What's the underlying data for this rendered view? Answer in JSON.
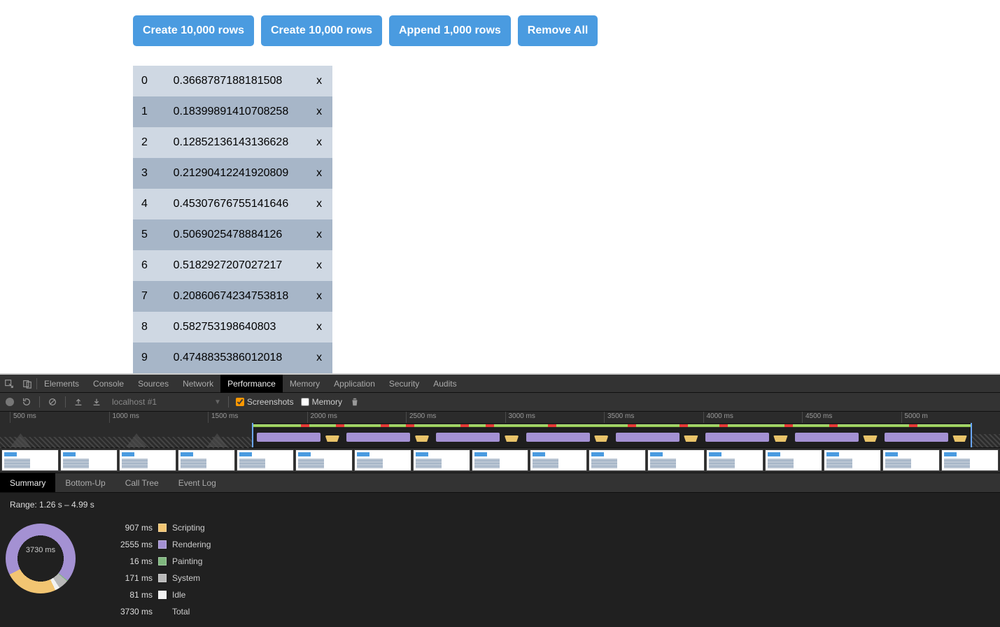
{
  "buttons": {
    "create10k_a": "Create 10,000 rows",
    "create10k_b": "Create 10,000 rows",
    "append1k": "Append 1,000 rows",
    "removeAll": "Remove All"
  },
  "rows": [
    {
      "idx": "0",
      "val": "0.3668787188181508",
      "del": "x"
    },
    {
      "idx": "1",
      "val": "0.18399891410708258",
      "del": "x"
    },
    {
      "idx": "2",
      "val": "0.12852136143136628",
      "del": "x"
    },
    {
      "idx": "3",
      "val": "0.21290412241920809",
      "del": "x"
    },
    {
      "idx": "4",
      "val": "0.45307676755141646",
      "del": "x"
    },
    {
      "idx": "5",
      "val": "0.5069025478884126",
      "del": "x"
    },
    {
      "idx": "6",
      "val": "0.5182927207027217",
      "del": "x"
    },
    {
      "idx": "7",
      "val": "0.20860674234753818",
      "del": "x"
    },
    {
      "idx": "8",
      "val": "0.582753198640803",
      "del": "x"
    },
    {
      "idx": "9",
      "val": "0.4748835386012018",
      "del": "x"
    }
  ],
  "devtools": {
    "tabs": [
      "Elements",
      "Console",
      "Sources",
      "Network",
      "Performance",
      "Memory",
      "Application",
      "Security",
      "Audits"
    ],
    "activeTab": "Performance",
    "toolbar": {
      "profile": "localhost #1",
      "screenshots_label": "Screenshots",
      "screenshots_checked": true,
      "memory_label": "Memory",
      "memory_checked": false
    },
    "overview": {
      "ticks": [
        "500 ms",
        "1000 ms",
        "1500 ms",
        "2000 ms",
        "2500 ms",
        "3000 ms",
        "3500 ms",
        "4000 ms",
        "4500 ms",
        "5000 m"
      ],
      "selStartPct": 25.2,
      "selEndPct": 97.2,
      "redMarksPct": [
        30,
        33.5,
        38,
        40.5,
        46,
        48.5,
        54.8,
        62.8,
        68,
        72,
        78.5,
        83,
        91
      ]
    },
    "subTabs": [
      "Summary",
      "Bottom-Up",
      "Call Tree",
      "Event Log"
    ],
    "activeSubTab": "Summary",
    "summary": {
      "range": "Range: 1.26 s – 4.99 s",
      "centerLabel": "3730 ms",
      "colors": {
        "scripting": "#f2c572",
        "rendering": "#a491d3",
        "painting": "#7fb77e",
        "system": "#b8b8b8",
        "idle": "#f2f2f2"
      },
      "items": [
        {
          "ms": "907 ms",
          "label": "Scripting",
          "colorKey": "scripting"
        },
        {
          "ms": "2555 ms",
          "label": "Rendering",
          "colorKey": "rendering"
        },
        {
          "ms": "16 ms",
          "label": "Painting",
          "colorKey": "painting"
        },
        {
          "ms": "171 ms",
          "label": "System",
          "colorKey": "system"
        },
        {
          "ms": "81 ms",
          "label": "Idle",
          "colorKey": "idle"
        },
        {
          "ms": "3730 ms",
          "label": "Total",
          "colorKey": null
        }
      ]
    }
  },
  "chart_data": {
    "type": "pie",
    "title": "Performance Summary (Range 1.26 s – 4.99 s)",
    "series": [
      {
        "name": "Scripting",
        "value_ms": 907,
        "color": "#f2c572"
      },
      {
        "name": "Rendering",
        "value_ms": 2555,
        "color": "#a491d3"
      },
      {
        "name": "Painting",
        "value_ms": 16,
        "color": "#7fb77e"
      },
      {
        "name": "System",
        "value_ms": 171,
        "color": "#b8b8b8"
      },
      {
        "name": "Idle",
        "value_ms": 81,
        "color": "#f2f2f2"
      }
    ],
    "total_ms": 3730
  }
}
